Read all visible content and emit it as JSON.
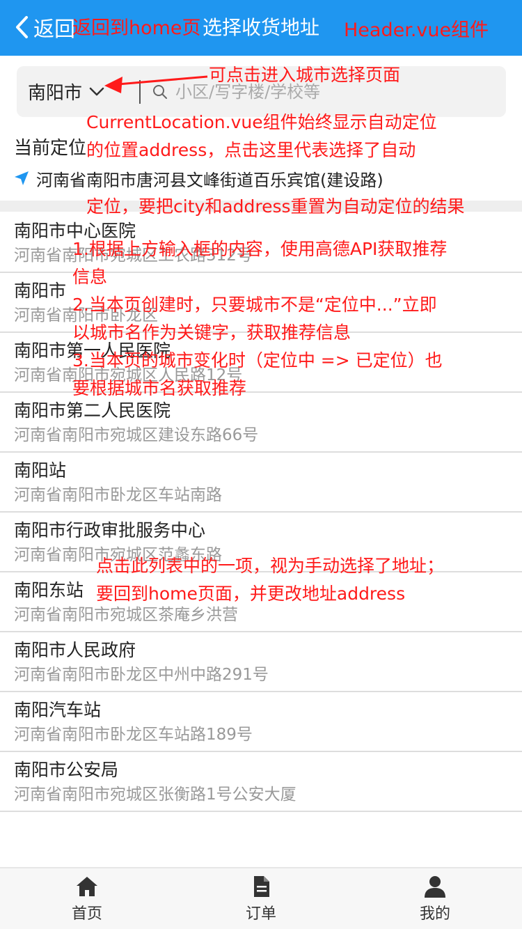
{
  "header": {
    "back_label": "返回",
    "title": "选择收货地址"
  },
  "search": {
    "city": "南阳市",
    "placeholder": "小区/写字楼/学校等",
    "value": ""
  },
  "current_location": {
    "label": "当前定位",
    "address": "河南省南阳市唐河县文峰街道百乐宾馆(建设路)"
  },
  "results": [
    {
      "name": "南阳市中心医院",
      "address": "河南省南阳市宛城区工农路312号"
    },
    {
      "name": "南阳市",
      "address": "河南省南阳市卧龙区"
    },
    {
      "name": "南阳市第一人民医院",
      "address": "河南省南阳市宛城区人民路12号"
    },
    {
      "name": "南阳市第二人民医院",
      "address": "河南省南阳市宛城区建设东路66号"
    },
    {
      "name": "南阳站",
      "address": "河南省南阳市卧龙区车站南路"
    },
    {
      "name": "南阳市行政审批服务中心",
      "address": "河南省南阳市宛城区范蠡东路"
    },
    {
      "name": "南阳东站",
      "address": "河南省南阳市宛城区茶庵乡洪营"
    },
    {
      "name": "南阳市人民政府",
      "address": "河南省南阳市卧龙区中州中路291号"
    },
    {
      "name": "南阳汽车站",
      "address": "河南省南阳市卧龙区车站路189号"
    },
    {
      "name": "南阳市公安局",
      "address": "河南省南阳市宛城区张衡路1号公安大厦"
    }
  ],
  "annotations": {
    "back_note": "返回到home页",
    "header_note": "Header.vue组件",
    "city_note": "可点击进入城市选择页面",
    "location_note_1": "CurrentLocation.vue组件始终显示自动定位",
    "location_note_2": "的位置address，点击这里代表选择了自动",
    "location_note_3": "定位，要把city和address重置为自动定位的结果",
    "list_note_1": "1.根据上方输入框的内容，使用高德API获取推荐",
    "list_note_2": "信息",
    "list_note_3": "2.当本页创建时，只要城市不是“定位中...”立即",
    "list_note_4": "以城市名作为关键字，获取推荐信息",
    "list_note_5": "3.当本页的城市变化时（定位中 => 已定位）也",
    "list_note_6": "要根据城市名获取推荐",
    "click_note_1": "点击此列表中的一项，视为手动选择了地址；",
    "click_note_2": "要回到home页面，并更改地址address"
  },
  "tabbar": {
    "home": "首页",
    "orders": "订单",
    "mine": "我的"
  },
  "colors": {
    "header_bg": "#1f96f0",
    "location_icon": "#1f96f0",
    "annotation": "#ff1a1a"
  },
  "icons": {
    "back": "chevron-left-icon",
    "dropdown": "chevron-down-icon",
    "search": "search-icon",
    "location": "location-arrow-icon",
    "home": "home-icon",
    "orders": "document-icon",
    "mine": "user-icon"
  }
}
